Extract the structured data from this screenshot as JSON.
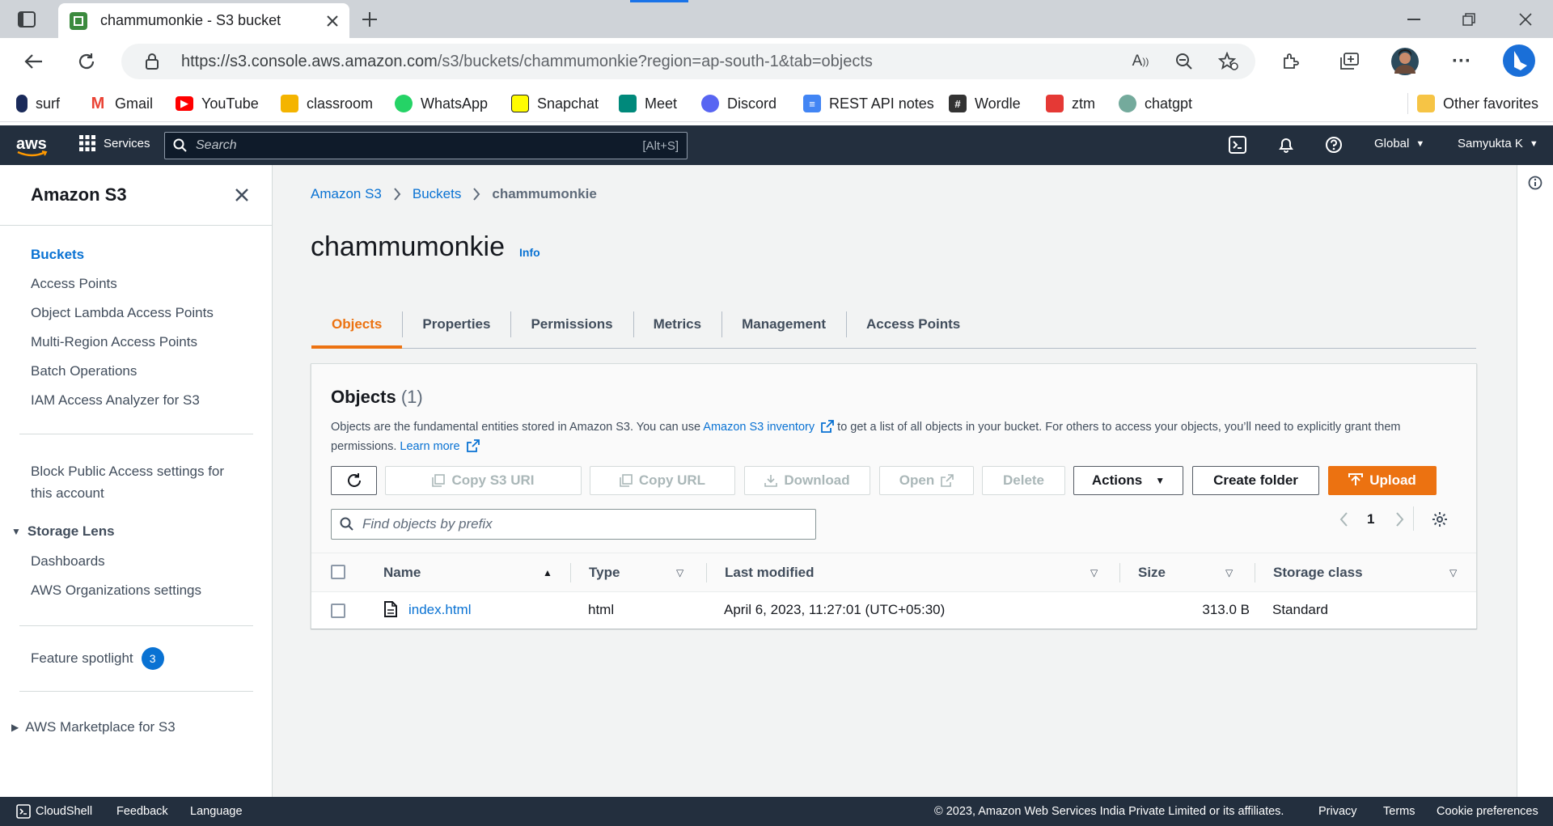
{
  "browser": {
    "tab_title": "chammumonkie - S3 bucket",
    "url_host": "https://s3.console.aws.amazon.com",
    "url_path": "/s3/buckets/chammumonkie?region=ap-south-1&tab=objects",
    "bookmarks": [
      {
        "label": "surf",
        "color": "#1a2a5a"
      },
      {
        "label": "Gmail",
        "color": "#ea4335"
      },
      {
        "label": "YouTube",
        "color": "#ff0000"
      },
      {
        "label": "classroom",
        "color": "#f4b400"
      },
      {
        "label": "WhatsApp",
        "color": "#25d366"
      },
      {
        "label": "Snapchat",
        "color": "#fffc00"
      },
      {
        "label": "Meet",
        "color": "#00897b"
      },
      {
        "label": "Discord",
        "color": "#5865f2"
      },
      {
        "label": "REST API notes",
        "color": "#4285f4"
      },
      {
        "label": "Wordle",
        "color": "#333333"
      },
      {
        "label": "ztm",
        "color": "#e53935"
      },
      {
        "label": "chatgpt",
        "color": "#74aa9c"
      }
    ],
    "other_favorites": "Other favorites"
  },
  "aws_header": {
    "logo": "aws",
    "services": "Services",
    "search_placeholder": "Search",
    "search_shortcut": "[Alt+S]",
    "region": "Global",
    "user": "Samyukta K"
  },
  "sidebar": {
    "title": "Amazon S3",
    "items": [
      "Buckets",
      "Access Points",
      "Object Lambda Access Points",
      "Multi-Region Access Points",
      "Batch Operations",
      "IAM Access Analyzer for S3"
    ],
    "block_public_line1": "Block Public Access settings for",
    "block_public_line2": "this account",
    "storage_lens": "Storage Lens",
    "storage_lens_items": [
      "Dashboards",
      "AWS Organizations settings"
    ],
    "feature_spotlight": "Feature spotlight",
    "feature_spotlight_count": "3",
    "marketplace": "AWS Marketplace for S3"
  },
  "main": {
    "breadcrumbs": [
      "Amazon S3",
      "Buckets",
      "chammumonkie"
    ],
    "title": "chammumonkie",
    "info": "Info",
    "tabs": [
      "Objects",
      "Properties",
      "Permissions",
      "Metrics",
      "Management",
      "Access Points"
    ],
    "objects": {
      "title": "Objects",
      "count": "(1)",
      "desc_1": "Objects are the fundamental entities stored in Amazon S3. You can use ",
      "desc_link": "Amazon S3 inventory",
      "desc_2": " to get a list of all objects in your bucket. For others to access your objects, you’ll need to explicitly grant them permissions. ",
      "learn_more": "Learn more",
      "buttons": {
        "copy_s3_uri": "Copy S3 URI",
        "copy_url": "Copy URL",
        "download": "Download",
        "open": "Open",
        "delete": "Delete",
        "actions": "Actions",
        "create_folder": "Create folder",
        "upload": "Upload"
      },
      "filter_placeholder": "Find objects by prefix",
      "page": "1",
      "columns": [
        "Name",
        "Type",
        "Last modified",
        "Size",
        "Storage class"
      ],
      "rows": [
        {
          "name": "index.html",
          "type": "html",
          "last_modified": "April 6, 2023, 11:27:01 (UTC+05:30)",
          "size": "313.0 B",
          "storage_class": "Standard"
        }
      ]
    }
  },
  "footer": {
    "cloudshell": "CloudShell",
    "feedback": "Feedback",
    "language": "Language",
    "copyright": "© 2023, Amazon Web Services India Private Limited or its affiliates.",
    "privacy": "Privacy",
    "terms": "Terms",
    "cookies": "Cookie preferences"
  },
  "colors": {
    "aws_dark": "#232f3e",
    "accent_orange": "#ec7211",
    "link_blue": "#0972d3"
  }
}
